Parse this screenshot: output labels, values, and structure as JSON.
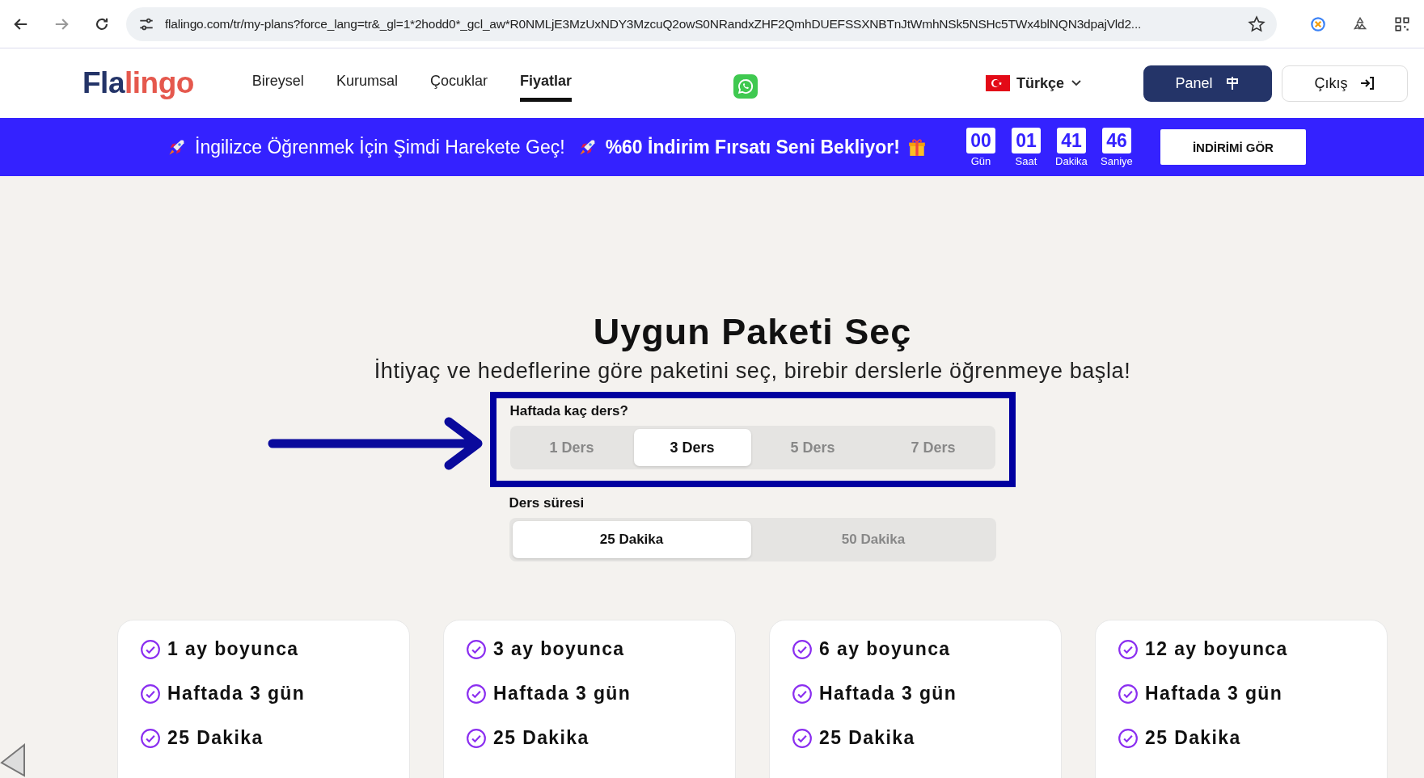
{
  "browser": {
    "url": "flalingo.com/tr/my-plans?force_lang=tr&_gl=1*2hodd0*_gcl_aw*R0NMLjE3MzUxNDY3MzcuQ2owS0NRandxZHF2QmhDUEFSSXNBTnJtWmhNSk5NSHc5TWx4blNQN3dpajVld2..."
  },
  "header": {
    "logo": {
      "dark_part": "Fla",
      "accent_part": "lingo"
    },
    "nav": [
      {
        "label": "Bireysel",
        "selected": false
      },
      {
        "label": "Kurumsal",
        "selected": false
      },
      {
        "label": "Çocuklar",
        "selected": false
      },
      {
        "label": "Fiyatlar",
        "selected": true
      }
    ],
    "language": "Türkçe",
    "panel_button": "Panel",
    "logout_button": "Çıkış"
  },
  "promo_banner": {
    "message": "İngilizce Öğrenmek İçin Şimdi Harekete Geç!",
    "offer": "%60 İndirim Fırsatı Seni Bekliyor!",
    "countdown": [
      {
        "value": "00",
        "unit": "Gün"
      },
      {
        "value": "01",
        "unit": "Saat"
      },
      {
        "value": "41",
        "unit": "Dakika"
      },
      {
        "value": "46",
        "unit": "Saniye"
      }
    ],
    "button": "İNDİRİMİ GÖR"
  },
  "title": "Uygun Paketi Seç",
  "subtitle": "İhtiyaç ve hedeflerine göre paketini seç, birebir derslerle öğrenmeye başla!",
  "lessons_per_week": {
    "label": "Haftada kaç ders?",
    "options": [
      {
        "label": "1 Ders",
        "selected": false
      },
      {
        "label": "3 Ders",
        "selected": true
      },
      {
        "label": "5 Ders",
        "selected": false
      },
      {
        "label": "7 Ders",
        "selected": false
      }
    ]
  },
  "lesson_duration": {
    "label": "Ders süresi",
    "options": [
      {
        "label": "25 Dakika",
        "selected": true
      },
      {
        "label": "50 Dakika",
        "selected": false
      }
    ]
  },
  "plans": [
    {
      "features": [
        "1 ay boyunca",
        "Haftada 3 gün",
        "25 Dakika"
      ]
    },
    {
      "features": [
        "3 ay boyunca",
        "Haftada 3 gün",
        "25 Dakika"
      ]
    },
    {
      "features": [
        "6 ay boyunca",
        "Haftada 3 gün",
        "25 Dakika"
      ]
    },
    {
      "features": [
        "12 ay boyunca",
        "Haftada 3 gün",
        "25 Dakika"
      ]
    }
  ]
}
